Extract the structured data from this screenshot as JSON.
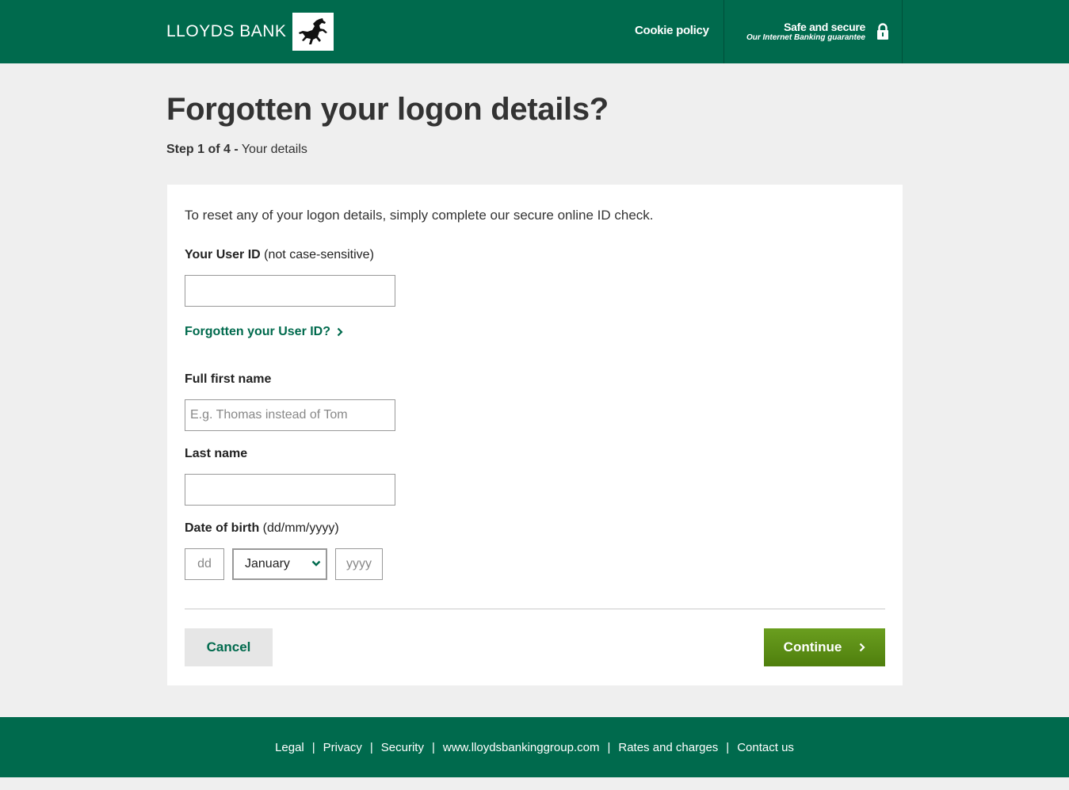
{
  "header": {
    "brand": "LLOYDS BANK",
    "cookie_policy": "Cookie policy",
    "safe_title": "Safe and secure",
    "safe_sub": "Our Internet Banking guarantee",
    "icons": [
      "black-horse-logo",
      "padlock-icon"
    ]
  },
  "page": {
    "title": "Forgotten your logon details?",
    "step_bold": "Step 1 of 4 -",
    "step_text": " Your details"
  },
  "form": {
    "intro": "To reset any of your logon details, simply complete our secure online ID check.",
    "user_id_label": "Your User ID",
    "user_id_hint": " (not case-sensitive)",
    "user_id_value": "",
    "forgot_user_id": "Forgotten your User ID?",
    "first_name_label": "Full first name",
    "first_name_placeholder": "E.g. Thomas instead of Tom",
    "last_name_label": "Last name",
    "last_name_value": "",
    "dob_label": "Date of birth",
    "dob_hint": " (dd/mm/yyyy)",
    "dob_day_placeholder": "dd",
    "dob_month_selected": "January",
    "dob_year_placeholder": "yyyy",
    "cancel": "Cancel",
    "continue": "Continue"
  },
  "footer": {
    "links": [
      "Legal",
      "Privacy",
      "Security",
      "www.lloydsbankinggroup.com",
      "Rates and charges",
      "Contact us"
    ]
  },
  "colors": {
    "brand_green": "#006a4d",
    "continue_green": "#5c8f16",
    "background": "#efefef"
  }
}
